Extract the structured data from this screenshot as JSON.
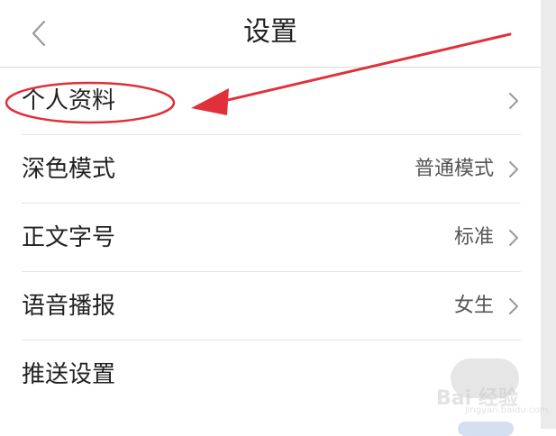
{
  "header": {
    "title": "设置",
    "back_icon": "chevron-left-icon"
  },
  "rows": [
    {
      "label": "个人资料",
      "value": "",
      "icon": "chevron-right-icon"
    },
    {
      "label": "深色模式",
      "value": "普通模式",
      "icon": "chevron-right-icon"
    },
    {
      "label": "正文字号",
      "value": "标准",
      "icon": "chevron-right-icon"
    },
    {
      "label": "语音播报",
      "value": "女生",
      "icon": "chevron-right-icon"
    },
    {
      "label": "推送设置",
      "value": "",
      "control": "toggle"
    }
  ],
  "annotation": {
    "color": "#e0303a",
    "shapes": [
      "highlight-ellipse",
      "pointer-arrow"
    ]
  },
  "watermark": {
    "text": "Bai 经验",
    "url": "jingyan.baidu.com"
  },
  "colors": {
    "divider": "#e4e4e4",
    "text": "#222222",
    "value_text": "#555555",
    "annotation": "#e0303a"
  }
}
